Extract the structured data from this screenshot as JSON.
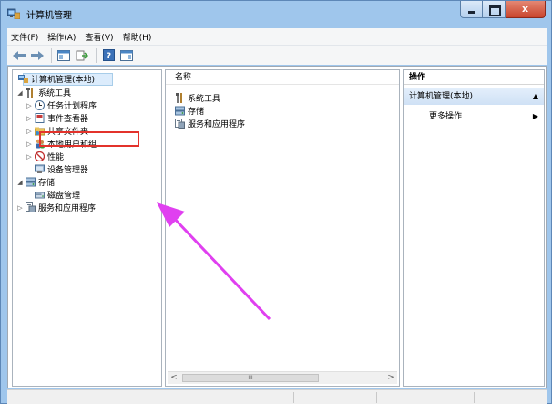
{
  "window": {
    "title": "计算机管理"
  },
  "menu": [
    {
      "label": "文件(F)"
    },
    {
      "label": "操作(A)"
    },
    {
      "label": "查看(V)"
    },
    {
      "label": "帮助(H)"
    }
  ],
  "tree": {
    "root": "计算机管理(本地)",
    "system_tools": "系统工具",
    "task_scheduler": "任务计划程序",
    "event_viewer": "事件查看器",
    "shared_folders": "共享文件夹",
    "local_users": "本地用户和组",
    "performance": "性能",
    "device_manager": "设备管理器",
    "storage": "存储",
    "disk_management": "磁盘管理",
    "services_apps": "服务和应用程序"
  },
  "middle": {
    "column_header": "名称",
    "items": [
      "系统工具",
      "存储",
      "服务和应用程序"
    ],
    "scroll_thumb": "III"
  },
  "actions": {
    "header": "操作",
    "group": "计算机管理(本地)",
    "more": "更多操作"
  },
  "colors": {
    "titlebar": "#9fc6ec",
    "highlight_box": "#e3322b",
    "annotation_arrow": "#e040f0"
  }
}
